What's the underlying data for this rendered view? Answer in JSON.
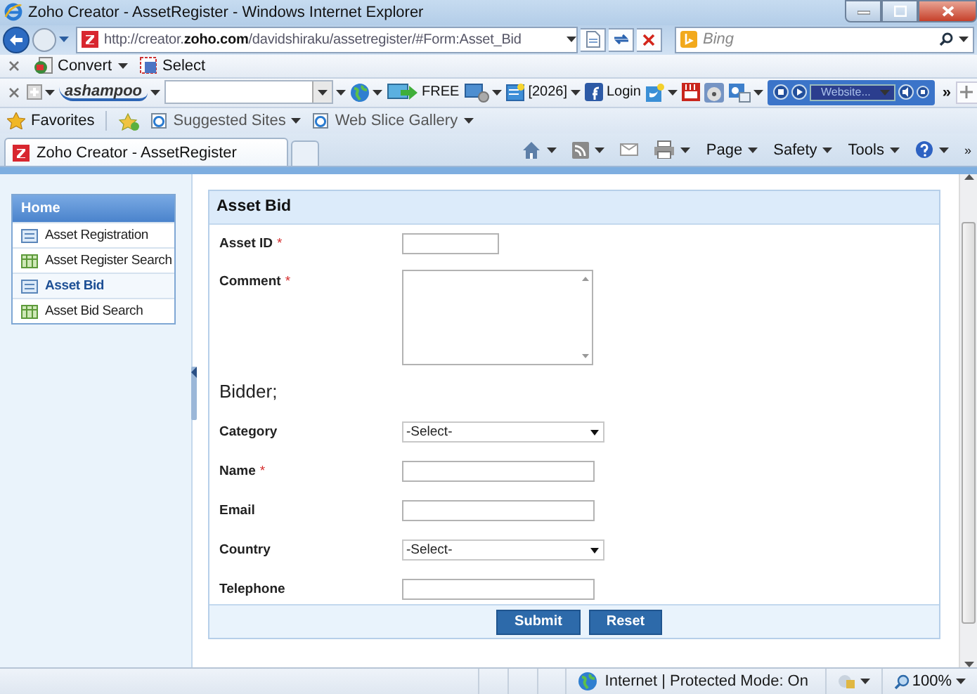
{
  "window": {
    "title": "Zoho Creator - AssetRegister - Windows Internet Explorer"
  },
  "address": {
    "url": "http://creator.**zoho.com**/davidshiraku/assetregister/#Form:Asset_Bid"
  },
  "search": {
    "placeholder": "Bing"
  },
  "toolbar_1": {
    "items": [
      {
        "kind": "close",
        "dropdown": false
      },
      {
        "kind": "convert",
        "label": "Convert",
        "dropdown": true
      },
      {
        "kind": "select",
        "label": "Select",
        "dropdown": false
      }
    ]
  },
  "toolbar_2": {
    "items": [
      {
        "kind": "close",
        "dropdown": false
      },
      {
        "kind": "addon",
        "dropdown": true
      },
      {
        "kind": "logo",
        "label": "ashampoo",
        "dropdown": true
      },
      {
        "kind": "combo",
        "dropdown": true
      },
      {
        "kind": "globe",
        "dropdown": true
      },
      {
        "kind": "free",
        "label": "FREE",
        "dropdown": false
      },
      {
        "kind": "tools",
        "dropdown": true
      },
      {
        "kind": "calendar",
        "label": "[2026]",
        "dropdown": true
      },
      {
        "kind": "facebook",
        "label": "Login",
        "dropdown": false
      },
      {
        "kind": "bird",
        "dropdown": true
      },
      {
        "kind": "video",
        "dropdown": false
      },
      {
        "kind": "disc",
        "dropdown": false
      },
      {
        "kind": "mail",
        "dropdown": true
      },
      {
        "kind": "player",
        "label": "Website...",
        "dropdown": false
      },
      {
        "kind": "overflow",
        "label": "»",
        "dropdown": false
      },
      {
        "kind": "newtab",
        "dropdown": false
      }
    ]
  },
  "favorites_bar": {
    "label": "Favorites",
    "links": [
      {
        "label": "Suggested Sites",
        "dropdown": true
      },
      {
        "label": "Web Slice Gallery",
        "dropdown": true
      }
    ]
  },
  "tabs": [
    {
      "label": "Zoho Creator - AssetRegister",
      "selected": true
    }
  ],
  "command_bar": [
    {
      "kind": "home",
      "dropdown": true
    },
    {
      "kind": "feed",
      "dropdown": true
    },
    {
      "kind": "mail",
      "dropdown": false
    },
    {
      "kind": "print",
      "dropdown": true
    },
    {
      "kind": "menu",
      "label": "Page",
      "dropdown": true
    },
    {
      "kind": "menu",
      "label": "Safety",
      "dropdown": true
    },
    {
      "kind": "menu",
      "label": "Tools",
      "dropdown": true
    },
    {
      "kind": "help",
      "dropdown": true
    },
    {
      "kind": "overflow",
      "label": "»",
      "dropdown": false
    }
  ],
  "sidebar": {
    "header": "Home",
    "items": [
      {
        "label": "Asset Registration",
        "kind": "form",
        "selected": false
      },
      {
        "label": "Asset Register Search",
        "kind": "report",
        "selected": false
      },
      {
        "label": "Asset Bid",
        "kind": "form",
        "selected": true
      },
      {
        "label": "Asset Bid Search",
        "kind": "report",
        "selected": false
      }
    ]
  },
  "form": {
    "title": "Asset Bid",
    "fields": [
      {
        "kind": "short_text",
        "label": "Asset ID",
        "required_mark": "*"
      },
      {
        "kind": "textarea",
        "label": "Comment",
        "required_mark": "*"
      },
      {
        "kind": "section",
        "label": "Bidder;"
      },
      {
        "kind": "select",
        "label": "Category",
        "value": "-Select-"
      },
      {
        "kind": "text",
        "label": "Name",
        "required_mark": "*"
      },
      {
        "kind": "text",
        "label": "Email"
      },
      {
        "kind": "select",
        "label": "Country",
        "value": "-Select-"
      },
      {
        "kind": "text",
        "label": "Telephone"
      }
    ],
    "buttons": [
      "Submit",
      "Reset"
    ]
  },
  "status_bar": {
    "zone": "Internet | Protected Mode: On",
    "zoom": "100%"
  }
}
